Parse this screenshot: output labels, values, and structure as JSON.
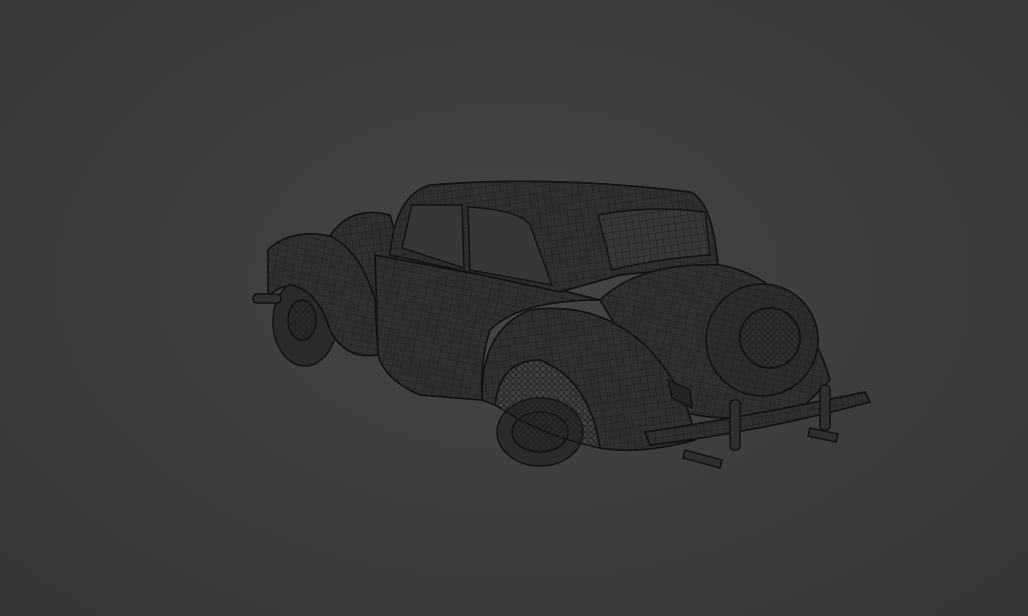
{
  "scene": {
    "subject": "car-wireframe-icon",
    "colors": {
      "background": "#3e3e3e",
      "body_fill": "#2f2f2f",
      "wire": "#1c1c1c",
      "outline": "#121212",
      "glass": "#373737"
    }
  }
}
